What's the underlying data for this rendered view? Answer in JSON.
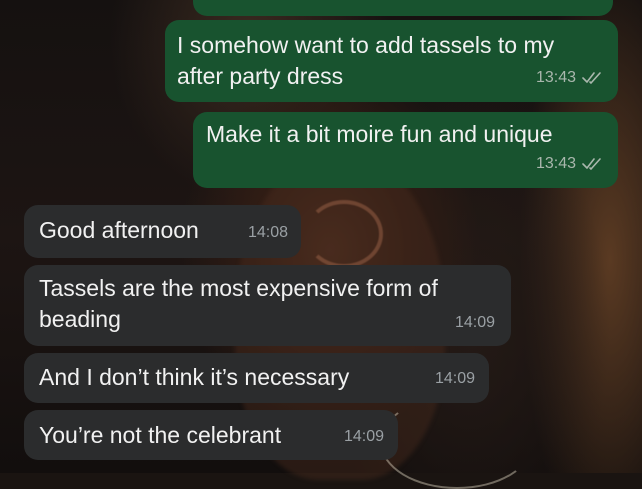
{
  "messages": [
    {
      "direction": "outgoing",
      "text_lines": [],
      "time": "",
      "status": "read"
    },
    {
      "direction": "outgoing",
      "text_lines": [
        "I somehow want to add tassels to my",
        "after party dress"
      ],
      "time": "13:43",
      "status": "read"
    },
    {
      "direction": "outgoing",
      "text_lines": [
        "Make it a bit moire fun and unique"
      ],
      "time": "13:43",
      "status": "read"
    },
    {
      "direction": "incoming",
      "text_lines": [
        "Good afternoon"
      ],
      "time": "14:08"
    },
    {
      "direction": "incoming",
      "text_lines": [
        "Tassels are the most expensive form of",
        "beading"
      ],
      "time": "14:09"
    },
    {
      "direction": "incoming",
      "text_lines": [
        "And I don’t think it’s necessary"
      ],
      "time": "14:09"
    },
    {
      "direction": "incoming",
      "text_lines": [
        "You’re not the celebrant"
      ],
      "time": "14:09"
    }
  ],
  "colors": {
    "outgoing_bubble": "#18532f",
    "incoming_bubble": "#2b2c2d",
    "text": "#f1f1f1",
    "meta_text": "#a9b7ad",
    "read_ticks": "#a9b7ad"
  },
  "icons": {
    "read_receipt": "double-check-icon"
  }
}
